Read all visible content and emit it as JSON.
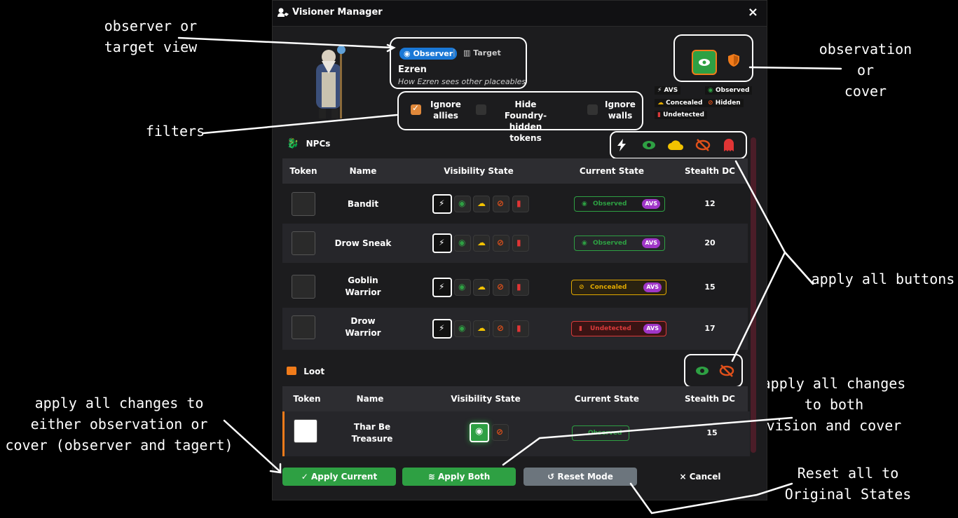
{
  "window": {
    "title": "Visioner Manager",
    "close_label": "×"
  },
  "mode": {
    "observer_label": "Observer",
    "separator": "|",
    "target_label": "Target",
    "token_name": "Ezren",
    "subtitle": "How Ezren sees other placeables"
  },
  "filters": [
    {
      "label_line1": "Ignore",
      "label_line2": "allies",
      "checked": true
    },
    {
      "label_line1": "Hide Foundry-",
      "label_line2": "hidden tokens",
      "checked": false
    },
    {
      "label_line1": "Ignore",
      "label_line2": "walls",
      "checked": false
    }
  ],
  "legend": {
    "avs": "AVS",
    "observed": "Observed",
    "concealed": "Concealed",
    "hidden": "Hidden",
    "undetected": "Undetected"
  },
  "columns": {
    "token": "Token",
    "name": "Name",
    "visibility": "Visibility State",
    "current": "Current State",
    "dc": "Stealth DC"
  },
  "npcs": {
    "title": "NPCs",
    "rows": [
      {
        "name_line1": "Bandit",
        "name_line2": "",
        "state": "Observed",
        "avs": "AVS",
        "dc": "12",
        "color": "#2ea043"
      },
      {
        "name_line1": "Drow Sneak",
        "name_line2": "",
        "state": "Observed",
        "avs": "AVS",
        "dc": "20",
        "color": "#2ea043"
      },
      {
        "name_line1": "Goblin",
        "name_line2": "Warrior",
        "state": "Concealed",
        "avs": "AVS",
        "dc": "15",
        "color": "#e0a800"
      },
      {
        "name_line1": "Drow",
        "name_line2": "Warrior",
        "state": "Undetected",
        "avs": "AVS",
        "dc": "17",
        "color": "#d93a3a"
      }
    ]
  },
  "loot": {
    "title": "Loot",
    "rows": [
      {
        "name_line1": "Thar Be",
        "name_line2": "Treasure",
        "state": "Observed",
        "dc": "15"
      }
    ]
  },
  "buttons": {
    "apply_current": "✓ Apply Current",
    "apply_both": "Apply Both",
    "reset": "Reset Mode",
    "cancel": "× Cancel"
  },
  "annotations": {
    "view_line1": "observer or",
    "view_line2": "target view",
    "filters": "filters",
    "obs_line1": "observation",
    "obs_line2": "or",
    "obs_line3": "cover",
    "apply_all": "apply all buttons",
    "ac_line1": "apply all changes to",
    "ac_line2": "either observation or",
    "ac_line3": "cover (observer and tagert)",
    "ab_line1": "apply all changes",
    "ab_line2": "to both",
    "ab_line3": "vision and cover",
    "reset_line1": "Reset all to",
    "reset_line2": "Original States"
  },
  "colors": {
    "observed": "#2ea043",
    "concealed": "#e0a800",
    "hidden": "#e0501a",
    "undetected": "#d93a3a",
    "avs": "#a036c8",
    "observer": "#1a78d6",
    "apply": "#2ea043",
    "reset": "#6c757d"
  }
}
